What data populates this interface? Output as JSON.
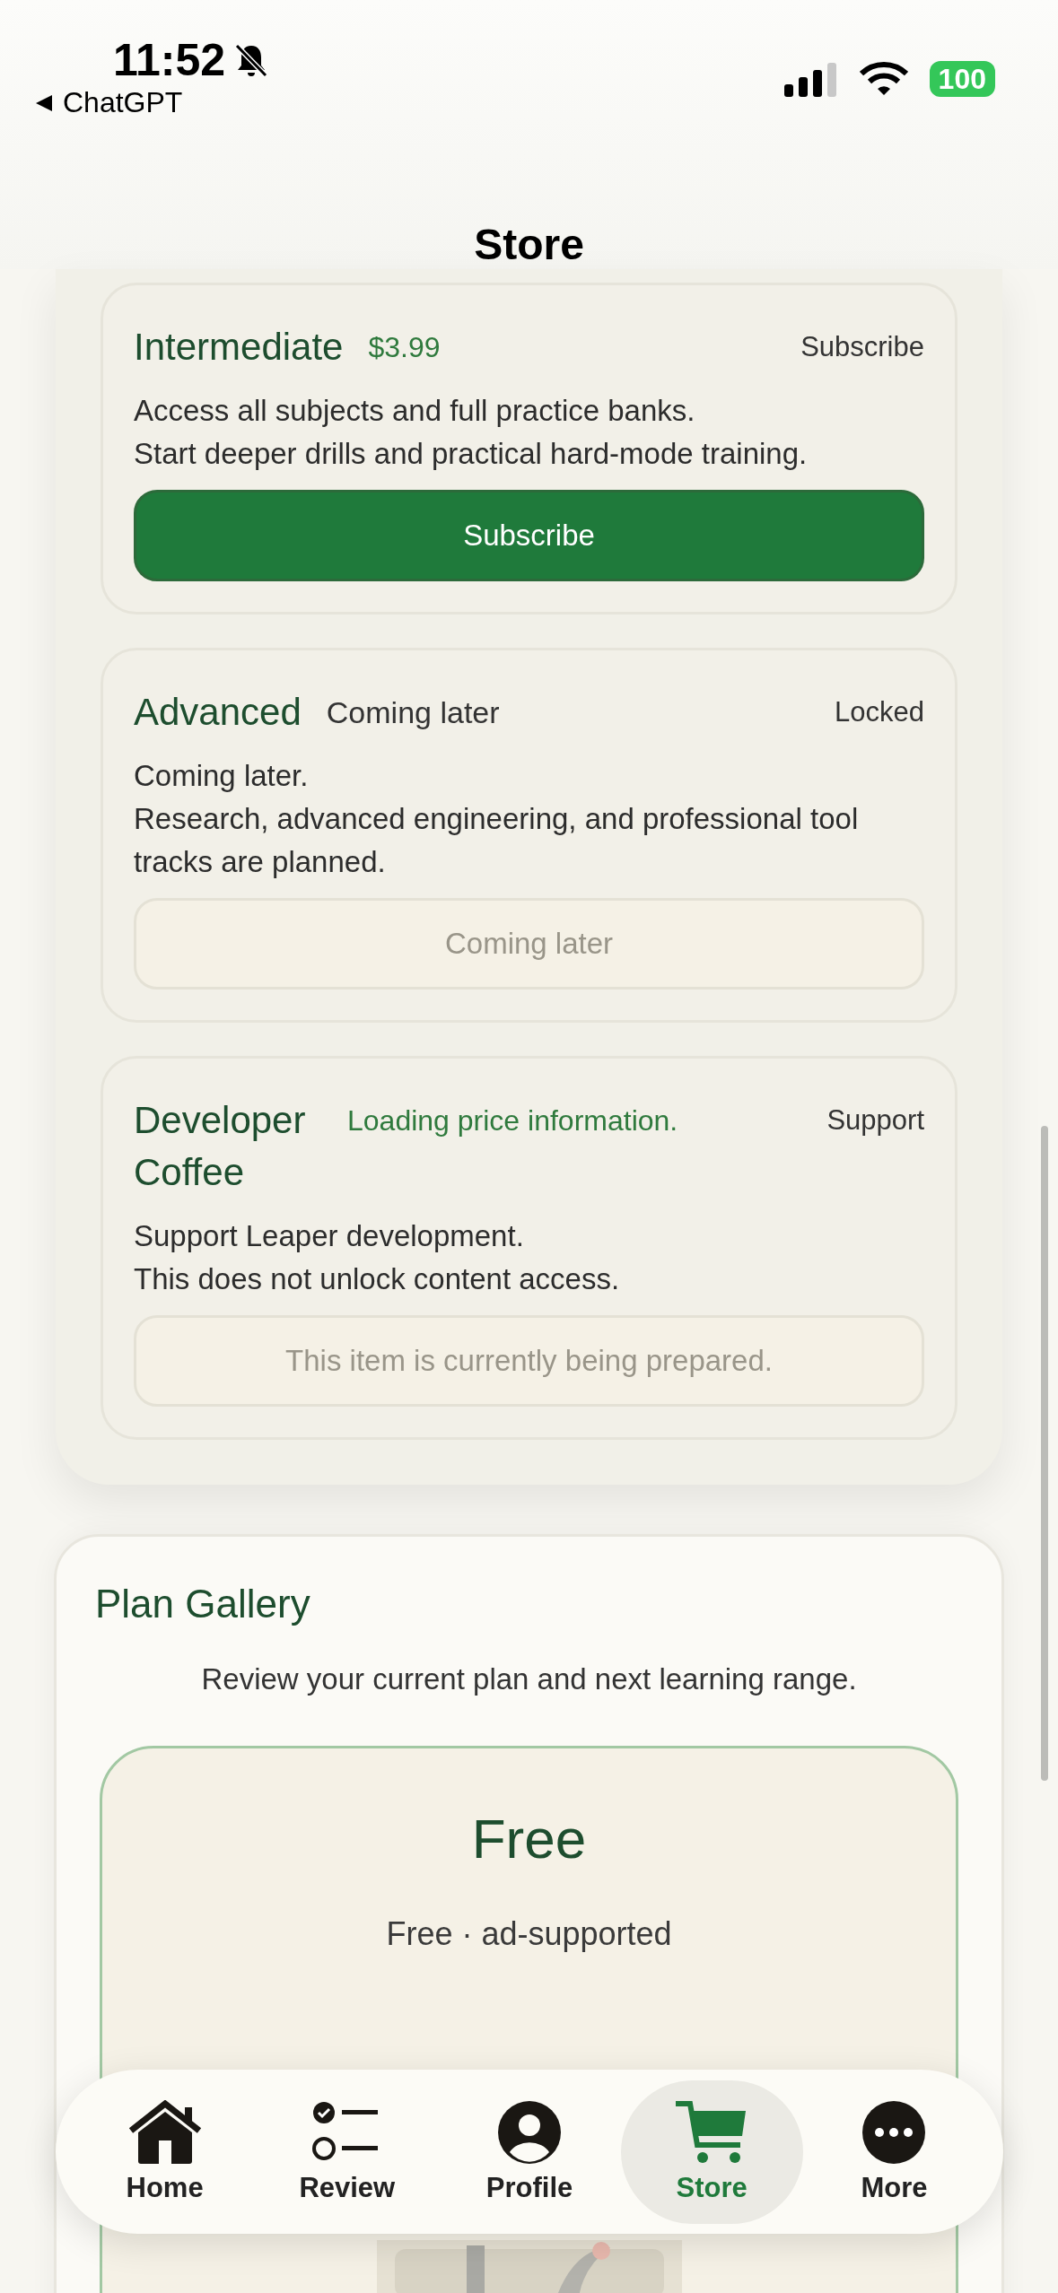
{
  "status_bar": {
    "time": "11:52",
    "back_label": "ChatGPT",
    "battery": "100"
  },
  "header": {
    "title": "Store"
  },
  "plans": [
    {
      "name": "Intermediate",
      "note": {
        "text": "$3.99",
        "kind": "price"
      },
      "status": "Subscribe",
      "description": [
        "Access all subjects and full practice banks.",
        "Start deeper drills and practical hard-mode training."
      ],
      "button": "Subscribe",
      "disabled": false
    },
    {
      "name": "Advanced",
      "note": {
        "text": "Coming later",
        "kind": "muted"
      },
      "status": "Locked",
      "description": [
        "Coming later.",
        "Research, advanced engineering, and professional tool tracks are planned."
      ],
      "button": "Coming later",
      "disabled": true
    },
    {
      "name": "Developer Coffee",
      "note": {
        "text": "Loading price information.",
        "kind": "info"
      },
      "status": "Support",
      "description": [
        "Support Leaper development.",
        "This does not unlock content access."
      ],
      "button": "This item is currently being prepared.",
      "disabled": true
    }
  ],
  "gallery": {
    "title": "Plan Gallery",
    "subtitle": "Review your current plan and next learning range.",
    "current": {
      "name": "Free",
      "detail": "Free · ad-supported",
      "kind": "picture"
    }
  },
  "tabs": [
    {
      "label": "Home",
      "kind": "home",
      "selected": false
    },
    {
      "label": "Review",
      "kind": "review",
      "selected": false
    },
    {
      "label": "Profile",
      "kind": "profile",
      "selected": false
    },
    {
      "label": "Store",
      "kind": "store",
      "selected": true
    },
    {
      "label": "More",
      "kind": "more",
      "selected": false
    }
  ]
}
